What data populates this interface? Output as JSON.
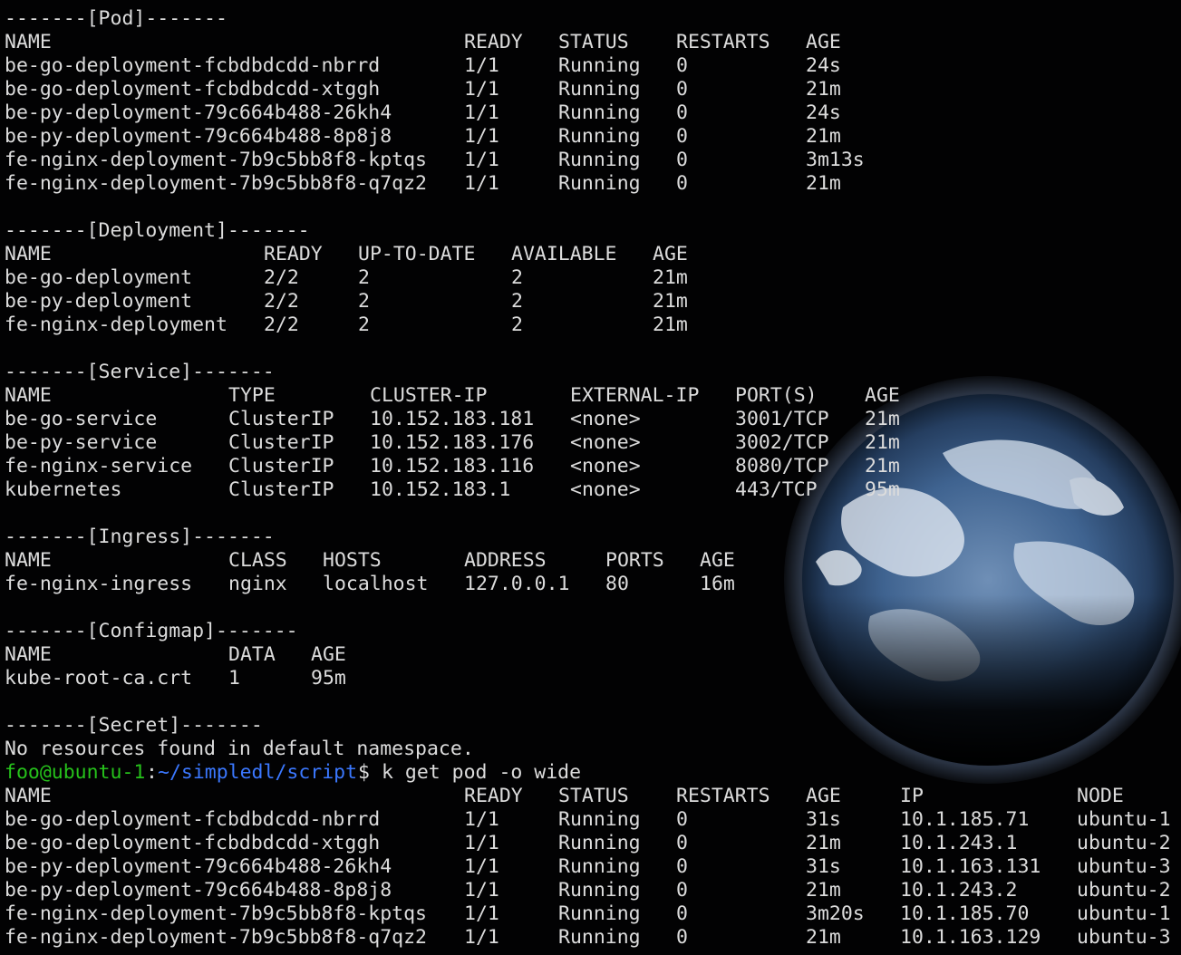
{
  "terminal": {
    "colors": {
      "background": "#020203",
      "text": "#dcdcdc",
      "prompt_user": "#26c21b",
      "prompt_path": "#3b78ff"
    },
    "background_image": "earth-photo",
    "lines": [
      {
        "cells": [
          "-------[Pod]-------"
        ]
      },
      {
        "cells": [
          "NAME",
          "READY",
          "STATUS",
          "RESTARTS",
          "AGE"
        ]
      },
      {
        "cells": [
          "be-go-deployment-fcbdbdcdd-nbrrd",
          "1/1",
          "Running",
          "0",
          "24s"
        ]
      },
      {
        "cells": [
          "be-go-deployment-fcbdbdcdd-xtggh",
          "1/1",
          "Running",
          "0",
          "21m"
        ]
      },
      {
        "cells": [
          "be-py-deployment-79c664b488-26kh4",
          "1/1",
          "Running",
          "0",
          "24s"
        ]
      },
      {
        "cells": [
          "be-py-deployment-79c664b488-8p8j8",
          "1/1",
          "Running",
          "0",
          "21m"
        ]
      },
      {
        "cells": [
          "fe-nginx-deployment-7b9c5bb8f8-kptqs",
          "1/1",
          "Running",
          "0",
          "3m13s"
        ]
      },
      {
        "cells": [
          "fe-nginx-deployment-7b9c5bb8f8-q7qz2",
          "1/1",
          "Running",
          "0",
          "21m"
        ]
      },
      {
        "cells": []
      },
      {
        "cells": [
          "-------[Deployment]-------"
        ]
      },
      {
        "cells": [
          "NAME",
          "READY",
          "UP-TO-DATE",
          "AVAILABLE",
          "AGE"
        ]
      },
      {
        "cells": [
          "be-go-deployment",
          "2/2",
          "2",
          "2",
          "21m"
        ]
      },
      {
        "cells": [
          "be-py-deployment",
          "2/2",
          "2",
          "2",
          "21m"
        ]
      },
      {
        "cells": [
          "fe-nginx-deployment",
          "2/2",
          "2",
          "2",
          "21m"
        ]
      },
      {
        "cells": []
      },
      {
        "cells": [
          "-------[Service]-------"
        ]
      },
      {
        "cells": [
          "NAME",
          "TYPE",
          "CLUSTER-IP",
          "EXTERNAL-IP",
          "PORT(S)",
          "AGE"
        ]
      },
      {
        "cells": [
          "be-go-service",
          "ClusterIP",
          "10.152.183.181",
          "<none>",
          "3001/TCP",
          "21m"
        ]
      },
      {
        "cells": [
          "be-py-service",
          "ClusterIP",
          "10.152.183.176",
          "<none>",
          "3002/TCP",
          "21m"
        ]
      },
      {
        "cells": [
          "fe-nginx-service",
          "ClusterIP",
          "10.152.183.116",
          "<none>",
          "8080/TCP",
          "21m"
        ]
      },
      {
        "cells": [
          "kubernetes",
          "ClusterIP",
          "10.152.183.1",
          "<none>",
          "443/TCP",
          "95m"
        ]
      },
      {
        "cells": []
      },
      {
        "cells": [
          "-------[Ingress]-------"
        ]
      },
      {
        "cells": [
          "NAME",
          "CLASS",
          "HOSTS",
          "ADDRESS",
          "PORTS",
          "AGE"
        ]
      },
      {
        "cells": [
          "fe-nginx-ingress",
          "nginx",
          "localhost",
          "127.0.0.1",
          "80",
          "16m"
        ]
      },
      {
        "cells": []
      },
      {
        "cells": [
          "-------[Configmap]-------"
        ]
      },
      {
        "cells": [
          "NAME",
          "DATA",
          "AGE"
        ]
      },
      {
        "cells": [
          "kube-root-ca.crt",
          "1",
          "95m"
        ]
      },
      {
        "cells": []
      },
      {
        "cells": [
          "-------[Secret]-------"
        ]
      },
      {
        "cells": [
          "No resources found in default namespace."
        ]
      },
      {
        "prompt": {
          "user": "foo@ubuntu-1",
          "sep": ":",
          "path": "~/simpledl/script",
          "symbol": "$",
          "command": "k get pod -o wide"
        }
      },
      {
        "cells": [
          "NAME",
          "READY",
          "STATUS",
          "RESTARTS",
          "AGE",
          "IP",
          "NODE"
        ]
      },
      {
        "cells": [
          "be-go-deployment-fcbdbdcdd-nbrrd",
          "1/1",
          "Running",
          "0",
          "31s",
          "10.1.185.71",
          "ubuntu-1"
        ]
      },
      {
        "cells": [
          "be-go-deployment-fcbdbdcdd-xtggh",
          "1/1",
          "Running",
          "0",
          "21m",
          "10.1.243.1",
          "ubuntu-2"
        ]
      },
      {
        "cells": [
          "be-py-deployment-79c664b488-26kh4",
          "1/1",
          "Running",
          "0",
          "31s",
          "10.1.163.131",
          "ubuntu-3"
        ]
      },
      {
        "cells": [
          "be-py-deployment-79c664b488-8p8j8",
          "1/1",
          "Running",
          "0",
          "21m",
          "10.1.243.2",
          "ubuntu-2"
        ]
      },
      {
        "cells": [
          "fe-nginx-deployment-7b9c5bb8f8-kptqs",
          "1/1",
          "Running",
          "0",
          "3m20s",
          "10.1.185.70",
          "ubuntu-1"
        ]
      },
      {
        "cells": [
          "fe-nginx-deployment-7b9c5bb8f8-q7qz2",
          "1/1",
          "Running",
          "0",
          "21m",
          "10.1.163.129",
          "ubuntu-3"
        ]
      }
    ]
  }
}
